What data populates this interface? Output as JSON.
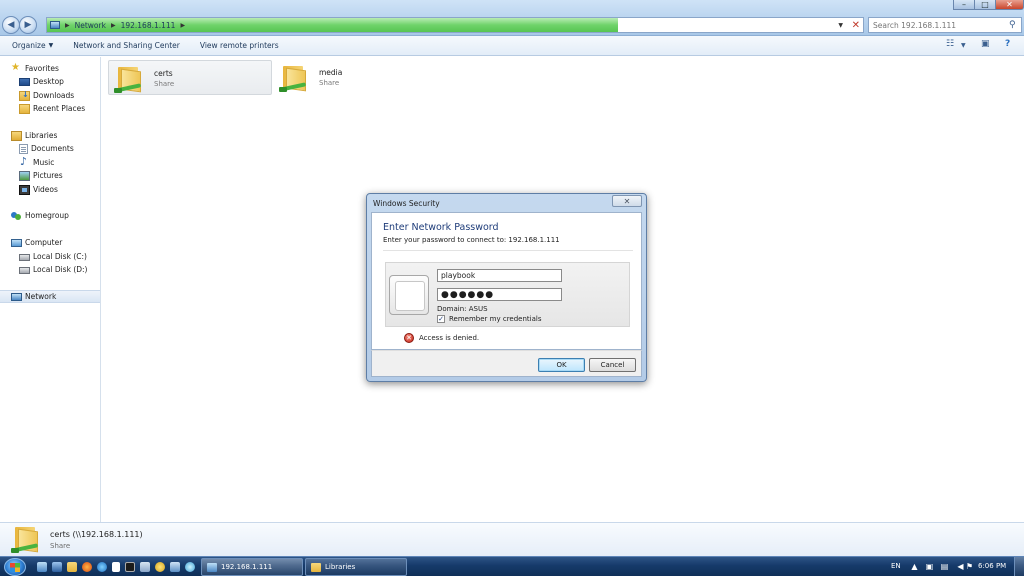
{
  "window": {
    "address": {
      "segments": [
        "Network",
        "192.168.1.111"
      ],
      "load_progress_percent": 70
    },
    "search_placeholder": "Search 192.168.1.111"
  },
  "toolbar": {
    "organize_label": "Organize",
    "network_center_label": "Network and Sharing Center",
    "view_printers_label": "View remote printers"
  },
  "nav": {
    "favorites": {
      "label": "Favorites",
      "items": [
        "Desktop",
        "Downloads",
        "Recent Places"
      ]
    },
    "libraries": {
      "label": "Libraries",
      "items": [
        "Documents",
        "Music",
        "Pictures",
        "Videos"
      ]
    },
    "homegroup": {
      "label": "Homegroup"
    },
    "computer": {
      "label": "Computer",
      "items": [
        "Local Disk (C:)",
        "Local Disk (D:)"
      ]
    },
    "network": {
      "label": "Network"
    }
  },
  "shares": [
    {
      "name": "certs",
      "type": "Share"
    },
    {
      "name": "media",
      "type": "Share"
    }
  ],
  "details": {
    "name": "certs (\\\\192.168.1.111)",
    "type": "Share"
  },
  "dialog": {
    "title": "Windows Security",
    "heading": "Enter Network Password",
    "subtitle": "Enter your password to connect to: 192.168.1.111",
    "username_value": "playbook",
    "password_mask": "●●●●●●",
    "domain_text": "Domain: ASUS",
    "remember_label": "Remember my credentials",
    "remember_checked": true,
    "error_text": "Access is denied.",
    "ok_label": "OK",
    "cancel_label": "Cancel"
  },
  "taskbar": {
    "buttons": [
      "192.168.1.111",
      "Libraries"
    ],
    "language": "EN",
    "clock": "6:06 PM"
  },
  "icons": {
    "start": "windows-start-orb",
    "folder": "network-share-folder-icon",
    "error": "error-x-icon"
  }
}
